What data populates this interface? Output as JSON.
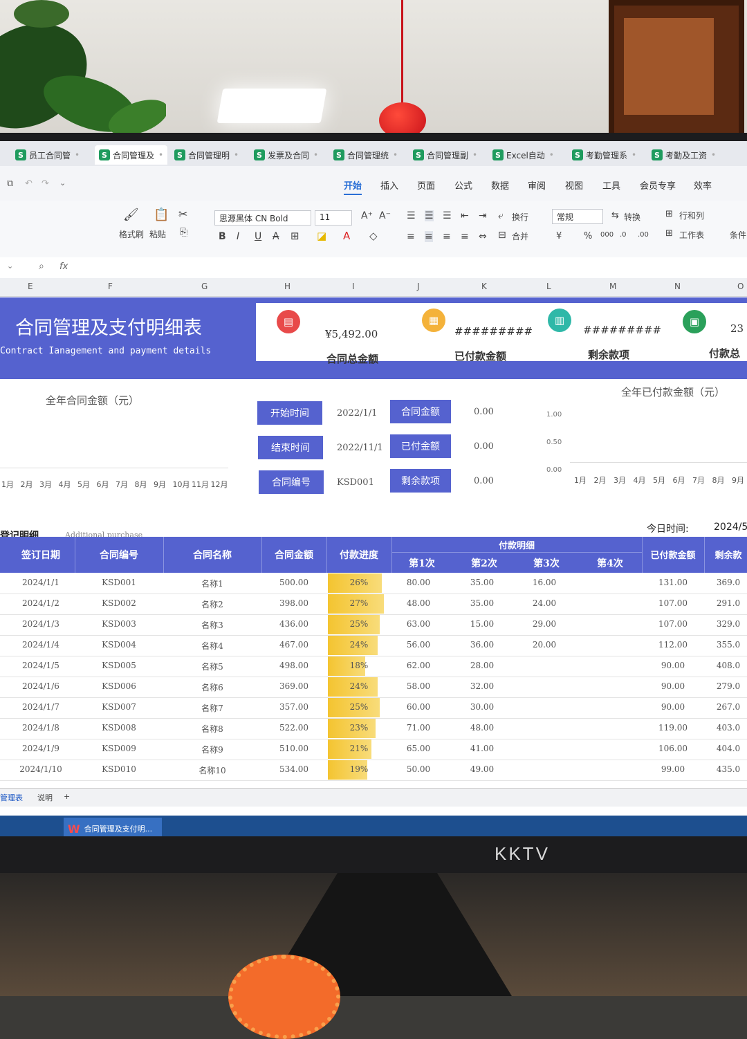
{
  "tabs": [
    {
      "label": "员工合同管"
    },
    {
      "label": "合同管理及"
    },
    {
      "label": "合同管理明"
    },
    {
      "label": "发票及合同"
    },
    {
      "label": "合同管理统"
    },
    {
      "label": "合同管理副"
    },
    {
      "label": "Excel自动"
    },
    {
      "label": "考勤管理系"
    },
    {
      "label": "考勤及工资"
    }
  ],
  "menu": [
    "开始",
    "插入",
    "页面",
    "公式",
    "数据",
    "审阅",
    "视图",
    "工具",
    "会员专享",
    "效率"
  ],
  "toolbar": {
    "format_painter": "格式刷",
    "paste": "粘贴",
    "font": "思源黑体 CN Bold",
    "font_size": "11",
    "wrap": "换行",
    "merge": "合并",
    "number_format": "常规",
    "convert": "转换",
    "row_col": "行和列",
    "worksheet": "工作表",
    "conditional": "条件"
  },
  "formula": {
    "cell_ref": "",
    "fx": "fx"
  },
  "columns": [
    "E",
    "F",
    "G",
    "H",
    "I",
    "J",
    "K",
    "L",
    "M",
    "N",
    "O"
  ],
  "banner": {
    "title": "合同管理及支付明细表",
    "subtitle": "Contract Ianagement and payment details"
  },
  "kpis": [
    {
      "value": "¥5,492.00",
      "label": "合同总金额",
      "color": "#e84a4a"
    },
    {
      "value": "#########",
      "label": "已付款金额",
      "color": "#f4b23a"
    },
    {
      "value": "#########",
      "label": "剩余款项",
      "color": "#2fb8a8"
    },
    {
      "value": "23",
      "label": "付款总",
      "color": "#2aa05a"
    }
  ],
  "left_chart": {
    "title": "全年合同金额（元）",
    "months": [
      "1月",
      "2月",
      "3月",
      "4月",
      "5月",
      "6月",
      "7月",
      "8月",
      "9月",
      "10月",
      "11月",
      "12月"
    ]
  },
  "right_chart": {
    "title": "全年已付款金额（元）",
    "ticks": [
      "1.00",
      "0.50",
      "0.00"
    ],
    "months": [
      "1月",
      "2月",
      "3月",
      "4月",
      "5月",
      "6月",
      "7月",
      "8月",
      "9月"
    ]
  },
  "filters": [
    {
      "label": "开始时间",
      "value": "2022/1/1",
      "key": "合同金额",
      "kval": "0.00"
    },
    {
      "label": "结束时间",
      "value": "2022/11/1",
      "key": "已付金额",
      "kval": "0.00"
    },
    {
      "label": "合同编号",
      "value": "KSD001",
      "key": "剩余款项",
      "kval": "0.00"
    }
  ],
  "section": {
    "title": "登记明细",
    "subtitle": "Additional purchase",
    "today_label": "今日时间:",
    "today_value": "2024/5"
  },
  "table": {
    "headers": {
      "date": "签订日期",
      "id": "合同编号",
      "name": "合同名称",
      "amount": "合同金额",
      "progress": "付款进度",
      "payment_group": "付款明细",
      "p1": "第1次",
      "p2": "第2次",
      "p3": "第3次",
      "p4": "第4次",
      "paid": "已付款金额",
      "remain": "剩余款"
    },
    "rows": [
      {
        "date": "2024/1/1",
        "id": "KSD001",
        "name": "名称1",
        "amount": "500.00",
        "progress": "26%",
        "pct": 26,
        "p1": "80.00",
        "p2": "35.00",
        "p3": "16.00",
        "p4": "",
        "paid": "131.00",
        "remain": "369.0"
      },
      {
        "date": "2024/1/2",
        "id": "KSD002",
        "name": "名称2",
        "amount": "398.00",
        "progress": "27%",
        "pct": 27,
        "p1": "48.00",
        "p2": "35.00",
        "p3": "24.00",
        "p4": "",
        "paid": "107.00",
        "remain": "291.0"
      },
      {
        "date": "2024/1/3",
        "id": "KSD003",
        "name": "名称3",
        "amount": "436.00",
        "progress": "25%",
        "pct": 25,
        "p1": "63.00",
        "p2": "15.00",
        "p3": "29.00",
        "p4": "",
        "paid": "107.00",
        "remain": "329.0"
      },
      {
        "date": "2024/1/4",
        "id": "KSD004",
        "name": "名称4",
        "amount": "467.00",
        "progress": "24%",
        "pct": 24,
        "p1": "56.00",
        "p2": "36.00",
        "p3": "20.00",
        "p4": "",
        "paid": "112.00",
        "remain": "355.0"
      },
      {
        "date": "2024/1/5",
        "id": "KSD005",
        "name": "名称5",
        "amount": "498.00",
        "progress": "18%",
        "pct": 18,
        "p1": "62.00",
        "p2": "28.00",
        "p3": "",
        "p4": "",
        "paid": "90.00",
        "remain": "408.0"
      },
      {
        "date": "2024/1/6",
        "id": "KSD006",
        "name": "名称6",
        "amount": "369.00",
        "progress": "24%",
        "pct": 24,
        "p1": "58.00",
        "p2": "32.00",
        "p3": "",
        "p4": "",
        "paid": "90.00",
        "remain": "279.0"
      },
      {
        "date": "2024/1/7",
        "id": "KSD007",
        "name": "名称7",
        "amount": "357.00",
        "progress": "25%",
        "pct": 25,
        "p1": "60.00",
        "p2": "30.00",
        "p3": "",
        "p4": "",
        "paid": "90.00",
        "remain": "267.0"
      },
      {
        "date": "2024/1/8",
        "id": "KSD008",
        "name": "名称8",
        "amount": "522.00",
        "progress": "23%",
        "pct": 23,
        "p1": "71.00",
        "p2": "48.00",
        "p3": "",
        "p4": "",
        "paid": "119.00",
        "remain": "403.0"
      },
      {
        "date": "2024/1/9",
        "id": "KSD009",
        "name": "名称9",
        "amount": "510.00",
        "progress": "21%",
        "pct": 21,
        "p1": "65.00",
        "p2": "41.00",
        "p3": "",
        "p4": "",
        "paid": "106.00",
        "remain": "404.0"
      },
      {
        "date": "2024/1/10",
        "id": "KSD010",
        "name": "名称10",
        "amount": "534.00",
        "progress": "19%",
        "pct": 19,
        "p1": "50.00",
        "p2": "49.00",
        "p3": "",
        "p4": "",
        "paid": "99.00",
        "remain": "435.0"
      }
    ]
  },
  "sheets": [
    "管理表",
    "说明",
    "+"
  ],
  "taskbar": {
    "app_label": "合同管理及支付明..."
  },
  "monitor_brand": "KKTV",
  "colors": {
    "accent": "#5562cf",
    "progress": "#f4c430"
  }
}
